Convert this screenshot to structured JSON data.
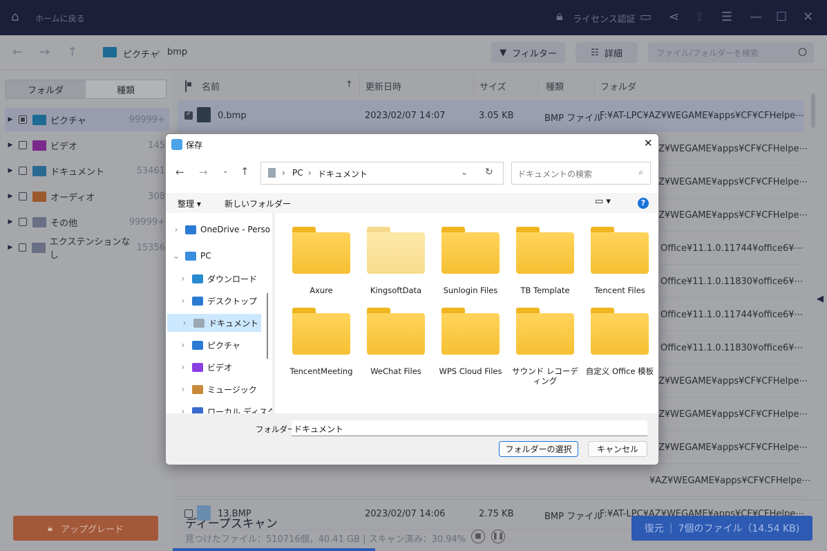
{
  "topbar": {
    "home_label": "ホームに戻る",
    "license_label": "ライセンス認証"
  },
  "navbar": {
    "breadcrumb": [
      "ピクチャ",
      "bmp"
    ],
    "filter_label": "フィルター",
    "detail_label": "詳細",
    "search_placeholder": "ファイル/フォルダーを検索"
  },
  "sidebar": {
    "tabs": [
      "フォルダ",
      "種類"
    ],
    "items": [
      {
        "label": "ピクチャ",
        "count": "99999+",
        "color": "#1d6b93",
        "state": "partial"
      },
      {
        "label": "ビデオ",
        "count": "145",
        "color": "#7a2a8a",
        "state": "none"
      },
      {
        "label": "ドキュメント",
        "count": "53461",
        "color": "#2a6a92",
        "state": "none"
      },
      {
        "label": "オーディオ",
        "count": "308",
        "color": "#9c5a2e",
        "state": "none"
      },
      {
        "label": "その他",
        "count": "99999+",
        "color": "#6b6f85",
        "state": "none"
      },
      {
        "label": "エクステンションなし",
        "count": "15356",
        "color": "#6b6f85",
        "state": "none"
      }
    ],
    "upgrade_label": "アップグレード"
  },
  "list": {
    "headers": [
      "名前",
      "更新日時",
      "サイズ",
      "種類",
      "フォルダ"
    ],
    "rows": [
      {
        "name": "0.bmp",
        "date": "2023/02/07 14:07",
        "size": "3.05 KB",
        "type": "BMP ファイル",
        "folder": "F:¥AT-LPC¥AZ¥WEGAME¥apps¥CF¥CFHelpe⋯",
        "checked": true
      },
      {
        "folder": "Z¥WEGAME¥apps¥CF¥CFHelpe⋯"
      },
      {
        "folder": "Z¥WEGAME¥apps¥CF¥CFHelpe⋯"
      },
      {
        "folder": "Z¥WEGAME¥apps¥CF¥CFHelpe⋯"
      },
      {
        "folder": "Office¥11.1.0.11744¥office6¥⋯"
      },
      {
        "folder": "Office¥11.1.0.11830¥office6¥⋯"
      },
      {
        "folder": "Office¥11.1.0.11744¥office6¥⋯"
      },
      {
        "folder": "Office¥11.1.0.11830¥office6¥⋯"
      },
      {
        "folder": "Z¥WEGAME¥apps¥CF¥CFHelpe⋯"
      },
      {
        "folder": "Z¥WEGAME¥apps¥CF¥CFHelpe⋯"
      },
      {
        "folder": "Z¥WEGAME¥apps¥CF¥CFHelpe⋯"
      },
      {
        "folder": "¥AZ¥WEGAME¥apps¥CF¥CFHelpe⋯"
      },
      {
        "name": "13.BMP",
        "date": "2023/02/07 14:06",
        "size": "2.75 KB",
        "type": "BMP ファイル",
        "folder": "F:¥AT-LPC¥AZ¥WEGAME¥apps¥CF¥CFHelpe⋯",
        "checked": false
      }
    ]
  },
  "status": {
    "title": "ディープスキャン",
    "detail": "見つけたファイル：510716個，40.41 GB | スキャン済み：30.94%",
    "progress": 0.3094
  },
  "recover": {
    "label": "復元",
    "count": "7個のファイル（14.54 KB)"
  },
  "dialog": {
    "title": "保存",
    "address": [
      "PC",
      "ドキュメント"
    ],
    "search_placeholder": "ドキュメントの検索",
    "organize": "整理",
    "new_folder": "新しいフォルダー",
    "tree": [
      "OneDrive - Perso",
      "PC",
      "ダウンロード",
      "デスクトップ",
      "ドキュメント",
      "ピクチャ",
      "ビデオ",
      "ミュージック",
      "ローカル ディスク"
    ],
    "folders": [
      {
        "name": "Axure"
      },
      {
        "name": "KingsoftData",
        "light": true
      },
      {
        "name": "Sunlogin Files"
      },
      {
        "name": "TB Template"
      },
      {
        "name": "Tencent Files"
      },
      {
        "name": "TencentMeeting"
      },
      {
        "name": "WeChat Files"
      },
      {
        "name": "WPS Cloud Files"
      },
      {
        "name": "サウンド レコーディング"
      },
      {
        "name": "自定义 Office 模板"
      }
    ],
    "folder_label": "フォルダー:",
    "folder_value": "ドキュメント",
    "select_label": "フォルダーの選択",
    "cancel_label": "キャンセル"
  }
}
